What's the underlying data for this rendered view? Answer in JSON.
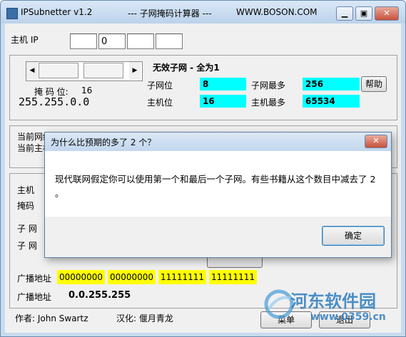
{
  "window": {
    "title_left": "IPSubnetter v1.2",
    "title_mid": "--- 子网掩码计算器 ---",
    "title_right": "WWW.BOSON.COM"
  },
  "host_ip": {
    "label": "主机 IP",
    "octets": [
      "",
      "0",
      "",
      ""
    ]
  },
  "mask": {
    "bits_label": "掩 码 位:",
    "bits_value": "16",
    "mask_value": "255.255.0.0"
  },
  "summary": {
    "heading": "无效子网 - 全为1",
    "subnet_bits_label": "子网位",
    "subnet_bits_value": "8",
    "max_subnets_label": "子网最多",
    "max_subnets_value": "256",
    "host_bits_label": "主机位",
    "host_bits_value": "16",
    "max_hosts_label": "主机最多",
    "max_hosts_value": "65534",
    "help_label": "帮助"
  },
  "current": {
    "network_label": "当前网络",
    "host_label": "当前主机"
  },
  "lower": {
    "host_label": "主机",
    "mask_label": "掩码",
    "subnet_label_1": "子 网",
    "subnet_label_2": "子 网",
    "broadcast_label": "广播地址",
    "broadcast_octets": [
      "00000000",
      "00000000",
      "11111111",
      "11111111"
    ],
    "broadcast_addr_label": "广播地址",
    "broadcast_addr_value": "0.0.255.255"
  },
  "footer": {
    "author": "作者: John Swartz",
    "translator": "汉化: 偃月青龙",
    "menu_label": "菜单",
    "exit_label": "退出"
  },
  "dialog": {
    "title": "为什么比预期的多了 2 个？",
    "message": "现代联网假定你可以使用第一个和最后一个子网。有些书籍从这个数目中减去了 2",
    "message_end": "。",
    "ok_label": "确定"
  },
  "watermark": {
    "text": "河东软件园",
    "url": "www.0359.cn"
  },
  "colors": {
    "cyan": "#00ffff",
    "yellow": "#ffff00",
    "titlebar": "#c8dbef"
  }
}
